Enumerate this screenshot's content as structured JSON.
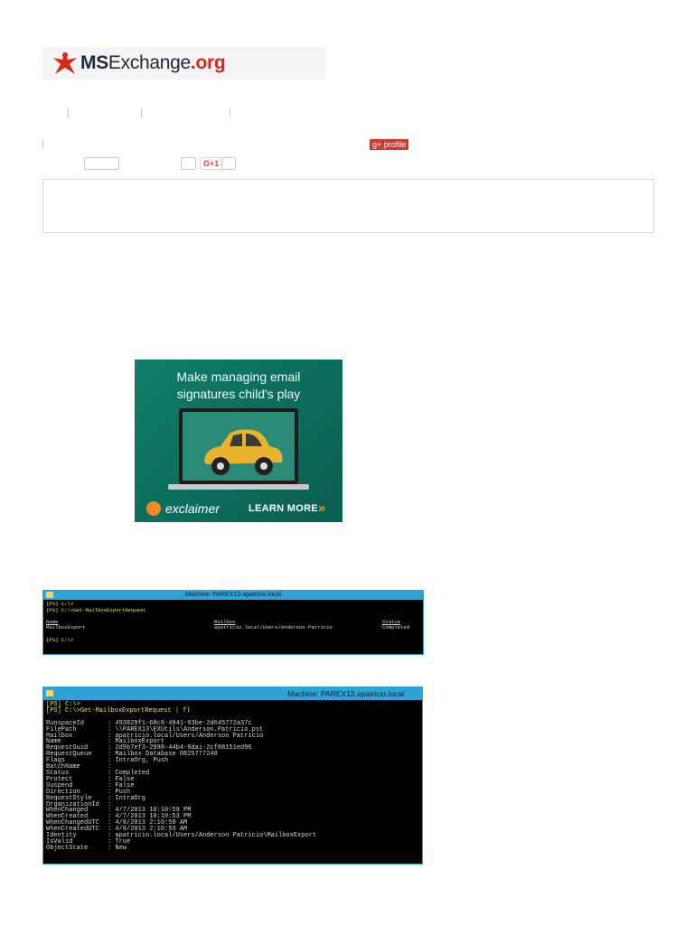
{
  "logo": {
    "ms": "MS",
    "exchange": "Exchange",
    "org": ".org",
    "colors": {
      "accent": "#d8281c",
      "dark": "#1c2a3a"
    }
  },
  "social": {
    "gplus_profile_label": "g+ profile",
    "gplus_one_label": "G+1"
  },
  "ad": {
    "headline_line1": "Make managing email",
    "headline_line2": "signatures child's play",
    "brand": "exclaimer",
    "cta": "LEARN MORE",
    "cta_arrows": "»",
    "colors": {
      "bg": "#0f7e6a",
      "accent": "#f08a24"
    }
  },
  "console1": {
    "title": "Machine: PAREX13.apatricio.local",
    "prompt1": "[PS] C:\\>",
    "cmd_prompt": "[PS] C:\\>",
    "cmd": "Get-MailboxExportRequest",
    "headers": {
      "name": "Name",
      "mailbox": "Mailbox",
      "status": "Status"
    },
    "row": {
      "name": "MailboxExport",
      "mailbox": "apatricio.local/Users/Anderson Patricio",
      "status": "Completed"
    },
    "prompt_end": "[PS] C:\\>"
  },
  "console2": {
    "title": "Machine: PAREX13.apatricio.local",
    "prompt1": "[PS] C:\\>",
    "cmd_prompt": "[PS] C:\\>",
    "cmd": "Get-MailboxExportRequest | fl",
    "props": [
      {
        "key": "RunspaceId",
        "value": "493829f1-68c8-4941-93be-2d645772a37c"
      },
      {
        "key": "FilePath",
        "value": "\\\\PAREX13\\EXUtils\\Anderson.Patricio.pst"
      },
      {
        "key": "Mailbox",
        "value": "apatricio.local/Users/Anderson Patricio"
      },
      {
        "key": "Name",
        "value": "MailboxExport"
      },
      {
        "key": "RequestGuid",
        "value": "2d9b7ef3-2998-44b4-8dai-2cf88151ed96"
      },
      {
        "key": "RequestQueue",
        "value": "Mailbox Database 0825777248"
      },
      {
        "key": "Flags",
        "value": "IntraOrg, Push"
      },
      {
        "key": "BatchName",
        "value": ""
      },
      {
        "key": "Status",
        "value": "Completed"
      },
      {
        "key": "Protect",
        "value": "False"
      },
      {
        "key": "Suspend",
        "value": "False"
      },
      {
        "key": "Direction",
        "value": "Push"
      },
      {
        "key": "RequestStyle",
        "value": "IntraOrg"
      },
      {
        "key": "OrganizationId",
        "value": ""
      },
      {
        "key": "WhenChanged",
        "value": "4/7/2013 10:10:59 PM"
      },
      {
        "key": "WhenCreated",
        "value": "4/7/2013 10:10:53 PM"
      },
      {
        "key": "WhenChangedUTC",
        "value": "4/8/2013 2:10:59 AM"
      },
      {
        "key": "WhenCreatedUTC",
        "value": "4/8/2013 2:10:53 AM"
      },
      {
        "key": "Identity",
        "value": "apatricio.local/Users/Anderson Patricio\\MailboxExport"
      },
      {
        "key": "IsValid",
        "value": "True"
      },
      {
        "key": "ObjectState",
        "value": "New"
      }
    ]
  }
}
